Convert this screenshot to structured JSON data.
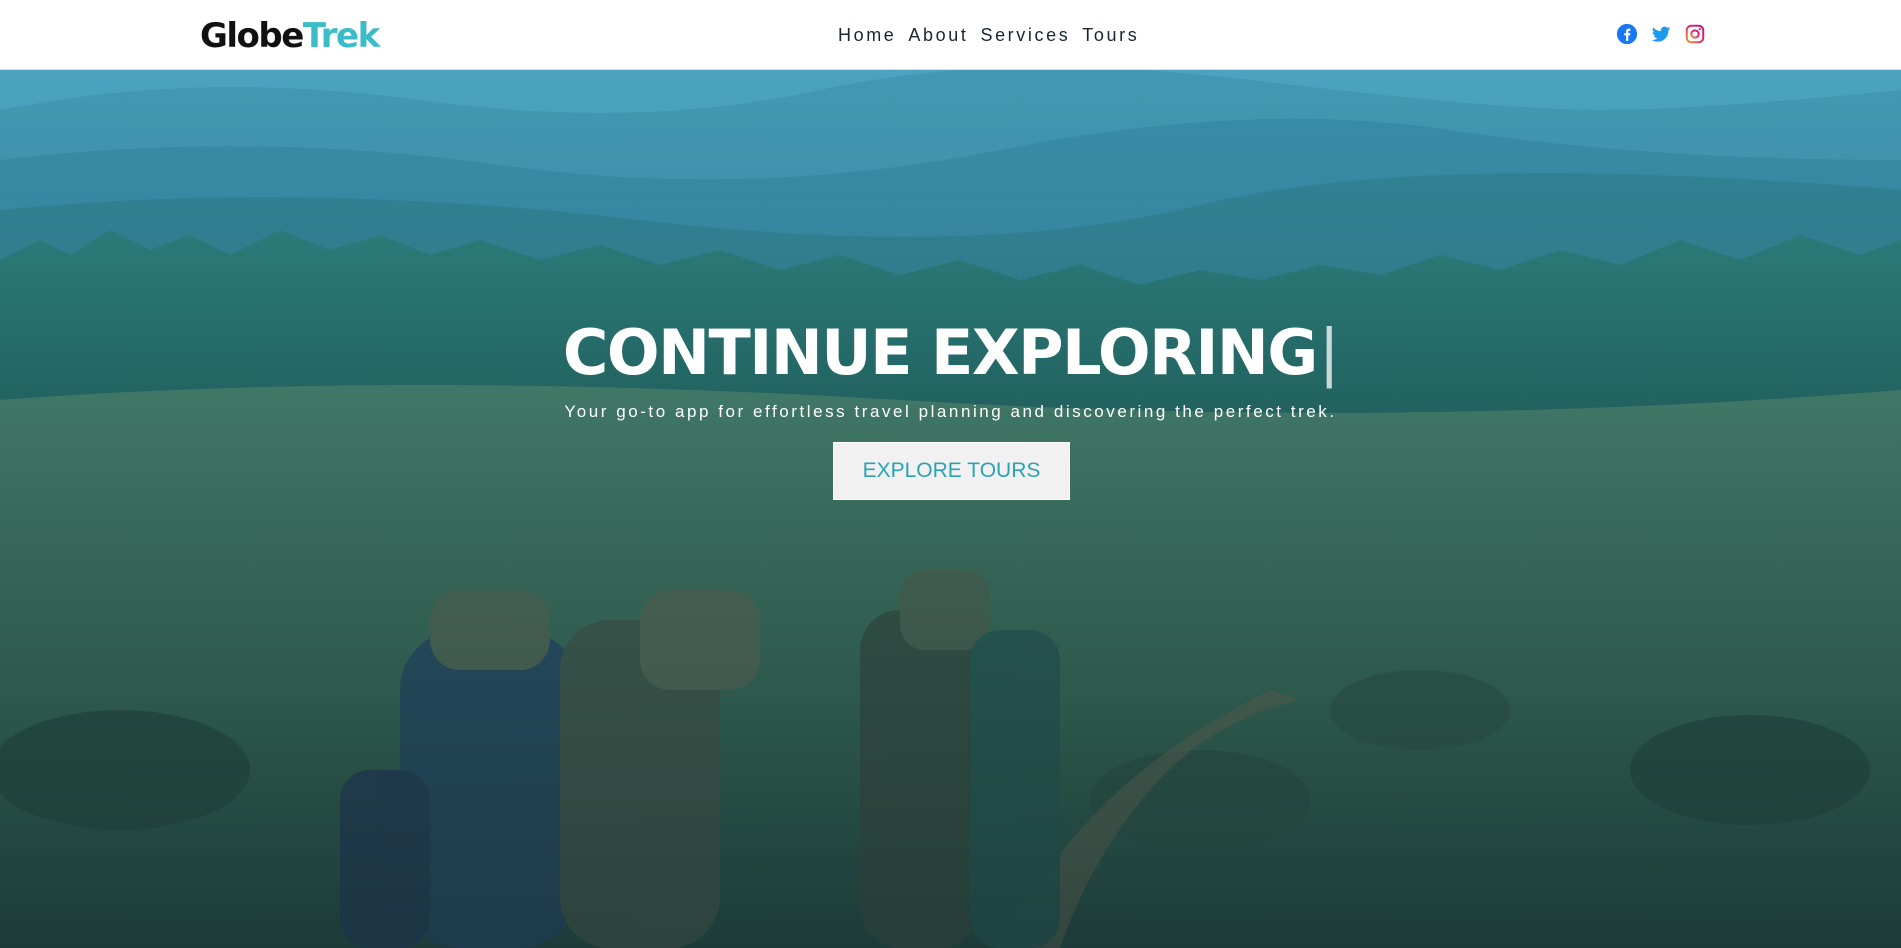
{
  "header": {
    "logo": {
      "part1": "Globe",
      "part2": "Trek"
    },
    "nav": [
      {
        "label": "Home"
      },
      {
        "label": "About"
      },
      {
        "label": "Services"
      },
      {
        "label": "Tours"
      }
    ],
    "social": [
      {
        "icon": "facebook-icon",
        "color": "#1877f2"
      },
      {
        "icon": "twitter-icon",
        "color": "#1d9bf0"
      },
      {
        "icon": "instagram-icon",
        "color": "#e1306c"
      }
    ]
  },
  "hero": {
    "title": "CONTINUE EXPLORING",
    "cursor": "|",
    "subtitle": "Your go-to app for effortless travel planning and discovering the perfect trek.",
    "cta_label": "EXPLORE TOURS"
  },
  "colors": {
    "accent": "#3bbcc9",
    "cta_text": "#2aa3b2",
    "nav_text": "#1a2533"
  }
}
